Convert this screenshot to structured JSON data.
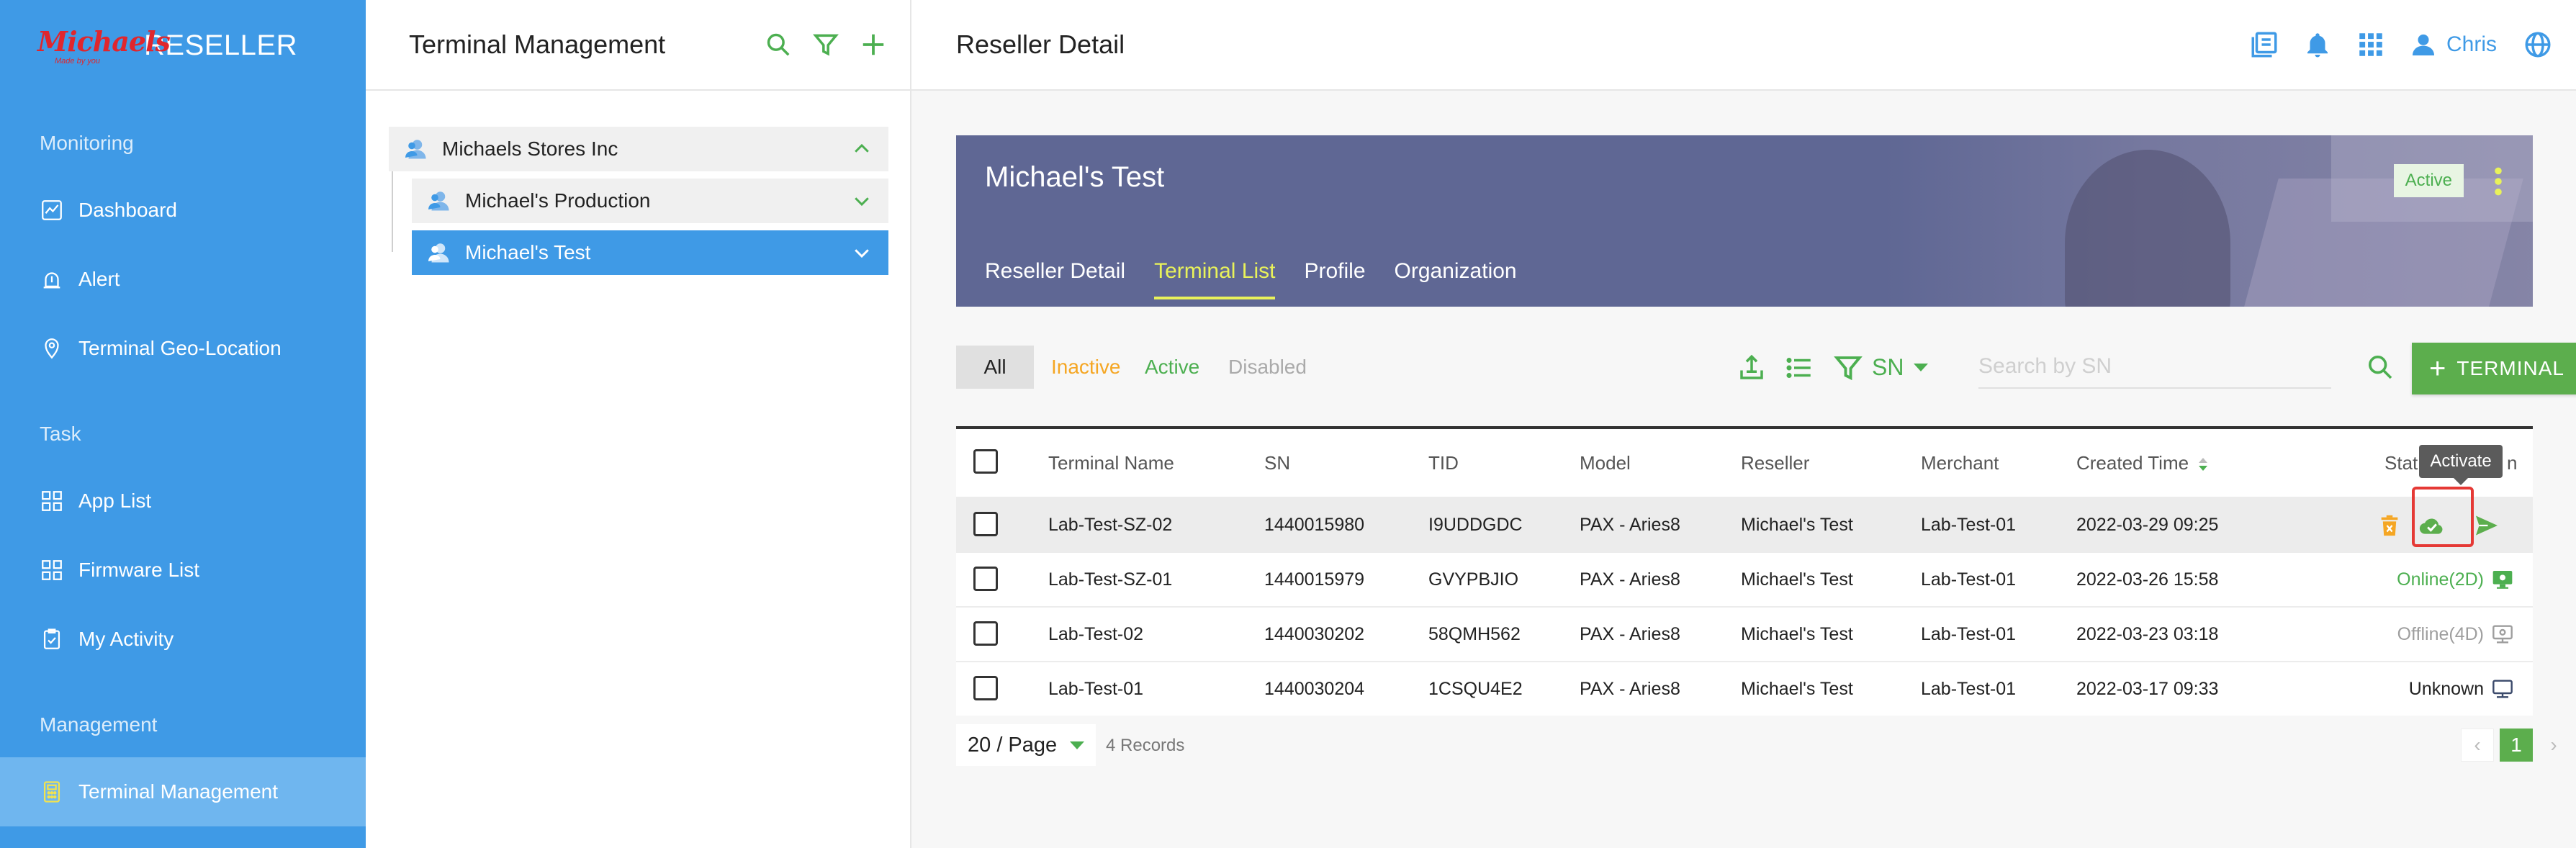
{
  "app": {
    "brand_logo_text": "Michaels",
    "brand_tagline": "Made by you",
    "brand_title": "RESELLER"
  },
  "sidebar": {
    "sections": [
      {
        "title": "Monitoring",
        "items": [
          {
            "label": "Dashboard",
            "icon": "chart-icon"
          },
          {
            "label": "Alert",
            "icon": "alarm-icon"
          },
          {
            "label": "Terminal Geo-Location",
            "icon": "location-icon"
          }
        ]
      },
      {
        "title": "Task",
        "items": [
          {
            "label": "App List",
            "icon": "grid-icon"
          },
          {
            "label": "Firmware List",
            "icon": "grid-icon"
          },
          {
            "label": "My Activity",
            "icon": "clipboard-icon"
          }
        ]
      },
      {
        "title": "Management",
        "items": [
          {
            "label": "Terminal Management",
            "icon": "calculator-icon",
            "active": true
          }
        ]
      }
    ]
  },
  "tree": {
    "title": "Terminal Management",
    "nodes": [
      {
        "label": "Michaels Stores Inc",
        "expanded": true
      },
      {
        "label": "Michael's Production",
        "expanded": false
      },
      {
        "label": "Michael's Test",
        "expanded": false,
        "selected": true
      }
    ]
  },
  "topbar": {
    "title": "Reseller Detail",
    "user_name": "Chris"
  },
  "hero": {
    "reseller_name": "Michael's Test",
    "status": "Active",
    "tabs": [
      {
        "label": "Reseller Detail",
        "active": false
      },
      {
        "label": "Terminal List",
        "active": true
      },
      {
        "label": "Profile",
        "active": false
      },
      {
        "label": "Organization",
        "active": false
      }
    ]
  },
  "filters": {
    "all": "All",
    "inactive": "Inactive",
    "active": "Active",
    "disabled": "Disabled",
    "search_field": "SN",
    "search_placeholder": "Search by SN",
    "add_button": "TERMINAL"
  },
  "table": {
    "columns": [
      "Terminal Name",
      "SN",
      "TID",
      "Model",
      "Reseller",
      "Merchant",
      "Created Time",
      "Stat",
      "n"
    ],
    "rows": [
      {
        "name": "Lab-Test-SZ-02",
        "sn": "1440015980",
        "tid": "I9UDDGDC",
        "model": "PAX - Aries8",
        "reseller": "Michael's Test",
        "merchant": "Lab-Test-01",
        "created": "2022-03-29 09:25",
        "status": ""
      },
      {
        "name": "Lab-Test-SZ-01",
        "sn": "1440015979",
        "tid": "GVYPBJIO",
        "model": "PAX - Aries8",
        "reseller": "Michael's Test",
        "merchant": "Lab-Test-01",
        "created": "2022-03-26 15:58",
        "status": "Online(2D)"
      },
      {
        "name": "Lab-Test-02",
        "sn": "1440030202",
        "tid": "58QMH562",
        "model": "PAX - Aries8",
        "reseller": "Michael's Test",
        "merchant": "Lab-Test-01",
        "created": "2022-03-23 03:18",
        "status": "Offline(4D)"
      },
      {
        "name": "Lab-Test-01",
        "sn": "1440030204",
        "tid": "1CSQU4E2",
        "model": "PAX - Aries8",
        "reseller": "Michael's Test",
        "merchant": "Lab-Test-01",
        "created": "2022-03-17 09:33",
        "status": "Unknown"
      }
    ]
  },
  "tooltip": "Activate",
  "pager": {
    "page_size": "20 / Page",
    "records": "4 Records",
    "current_page": "1"
  },
  "colors": {
    "sidebar": "#3f9ae6",
    "accent_green": "#5cae4d",
    "inactive_orange": "#f5a623",
    "hero": "#5f6794",
    "tab_active": "#e9f25a"
  }
}
